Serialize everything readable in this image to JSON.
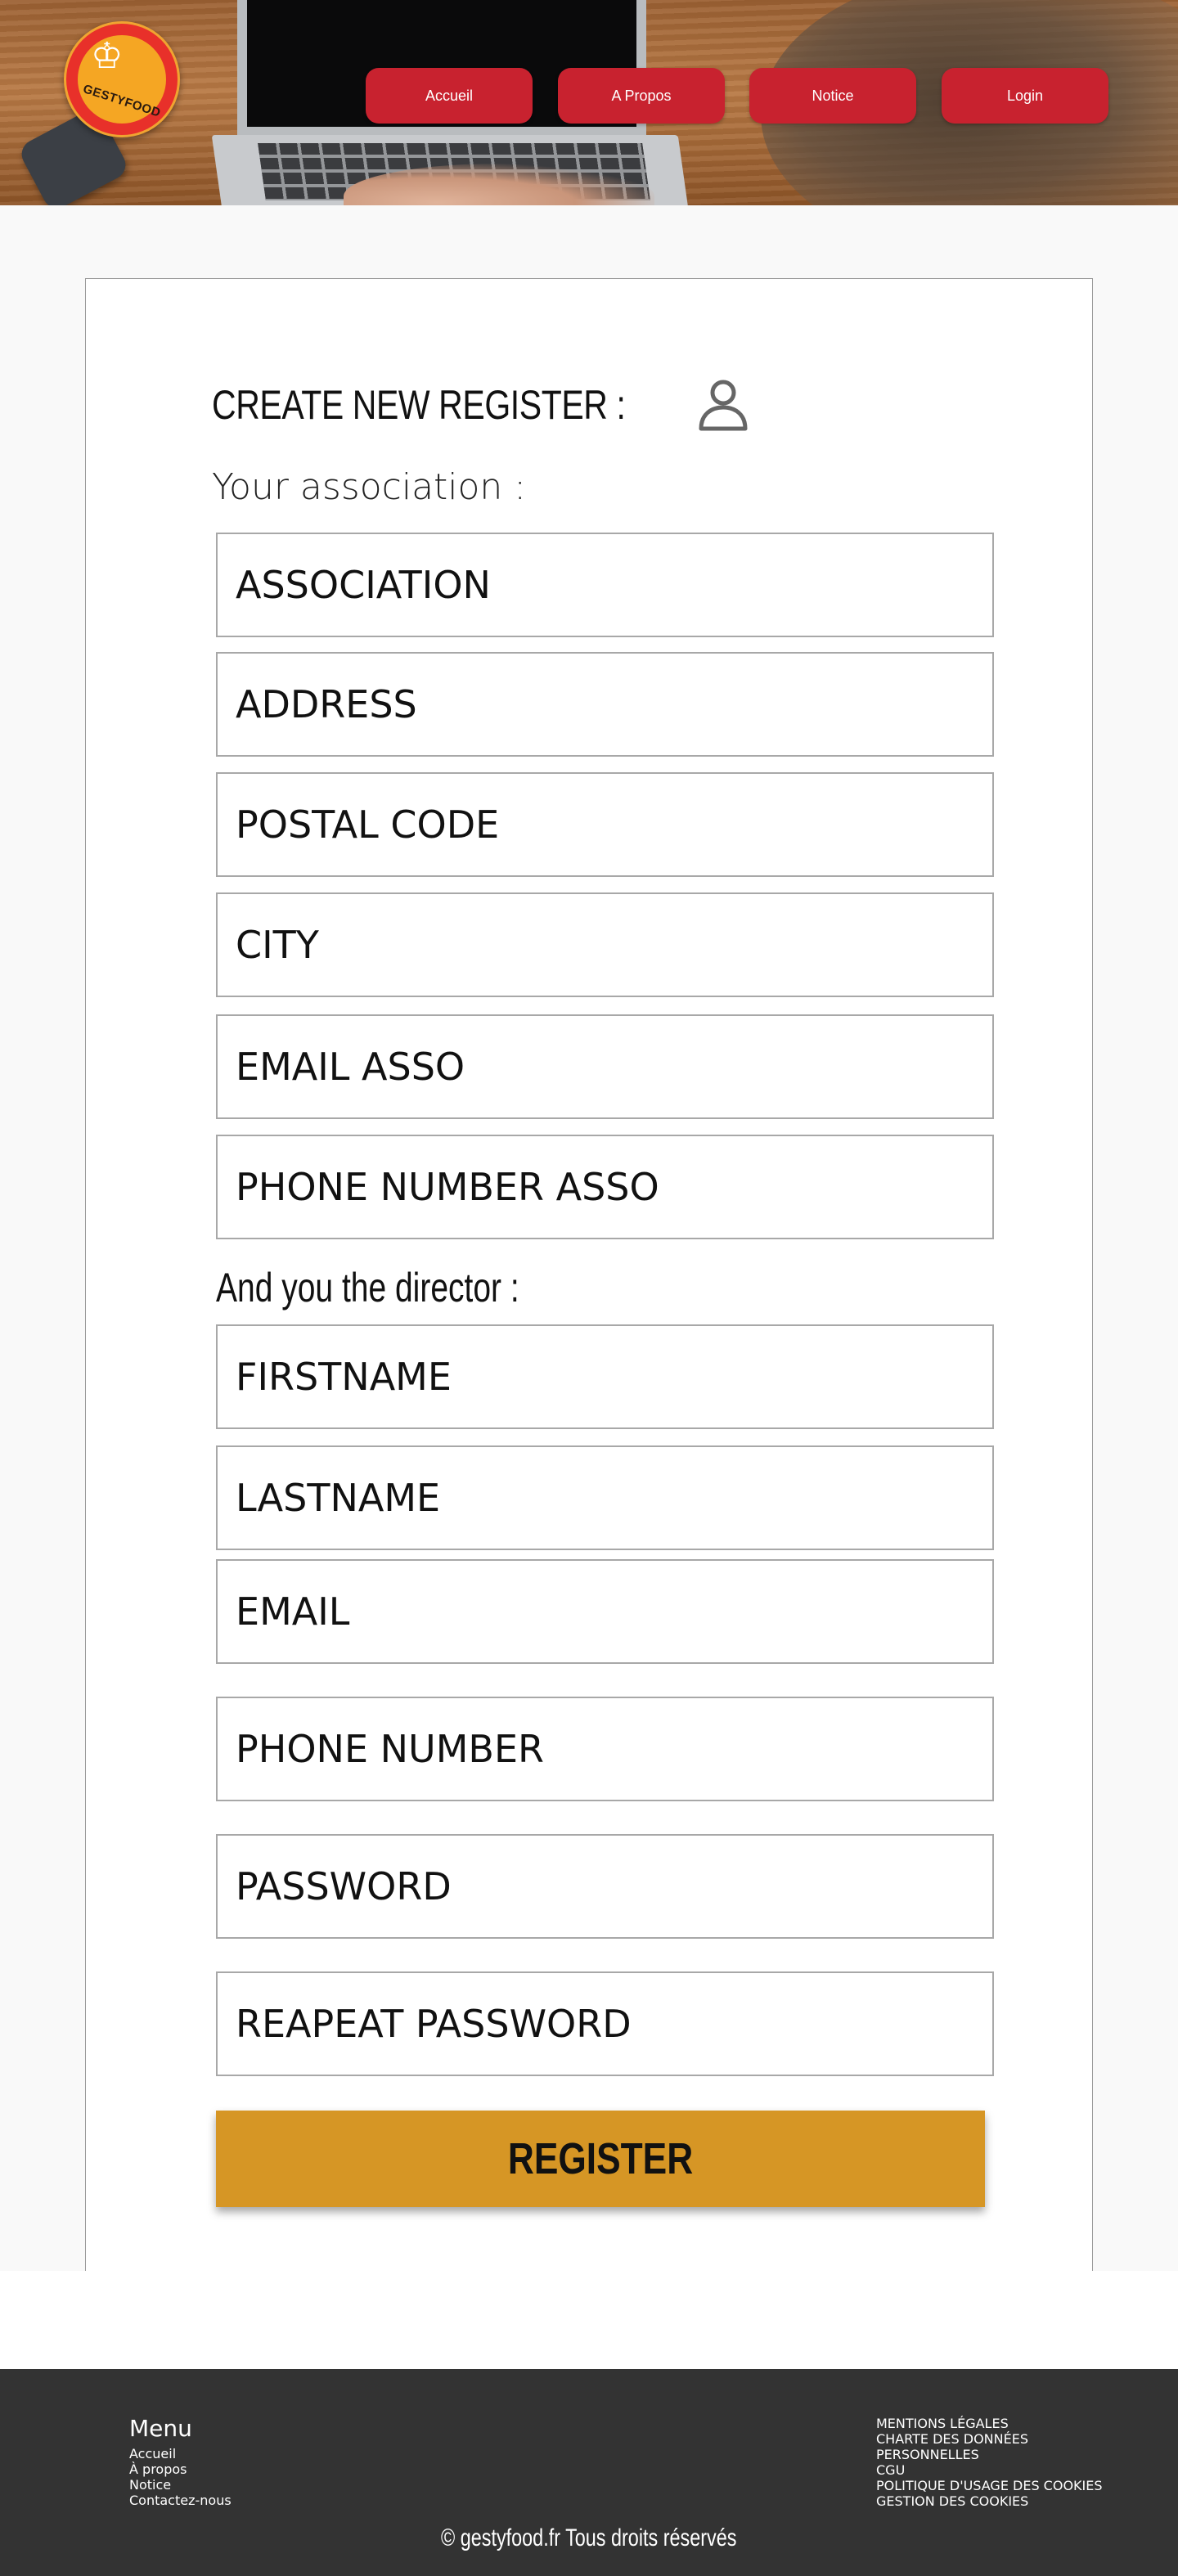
{
  "brand": {
    "logo_text": "GESTYFOOD"
  },
  "nav": {
    "items": [
      {
        "label": "Accueil"
      },
      {
        "label": "A Propos"
      },
      {
        "label": "Notice"
      },
      {
        "label": "Login"
      }
    ]
  },
  "form": {
    "title": "CREATE NEW REGISTER :",
    "association_section_label": "Your association :",
    "director_section_label": "And you the director :",
    "association_fields": [
      {
        "placeholder": "ASSOCIATION"
      },
      {
        "placeholder": "ADDRESS"
      },
      {
        "placeholder": "POSTAL CODE"
      },
      {
        "placeholder": "CITY"
      },
      {
        "placeholder": "EMAIL ASSO"
      },
      {
        "placeholder": "PHONE NUMBER ASSO"
      }
    ],
    "director_fields": [
      {
        "placeholder": "FIRSTNAME"
      },
      {
        "placeholder": "LASTNAME"
      },
      {
        "placeholder": "EMAIL"
      },
      {
        "placeholder": "PHONE NUMBER"
      },
      {
        "placeholder": "PASSWORD"
      },
      {
        "placeholder": "REAPEAT PASSWORD"
      }
    ],
    "submit_label": "REGISTER",
    "icons": {
      "user": "user-icon"
    }
  },
  "footer": {
    "menu_title": "Menu",
    "menu_items": [
      "Accueil",
      "À propos",
      "Notice",
      "Contactez-nous"
    ],
    "legal_items": [
      "MENTIONS LÉGALES",
      "CHARTE DES DONNÉES",
      "PERSONNELLES",
      "CGU",
      "POLITIQUE D'USAGE DES COOKIES",
      "GESTION DES COOKIES"
    ],
    "copyright": "© gestyfood.fr  Tous droits réservés"
  },
  "colors": {
    "nav_button": "#c8222f",
    "register_button": "#d69625",
    "footer_bg": "#333333",
    "page_bg": "#f9f9f9"
  }
}
